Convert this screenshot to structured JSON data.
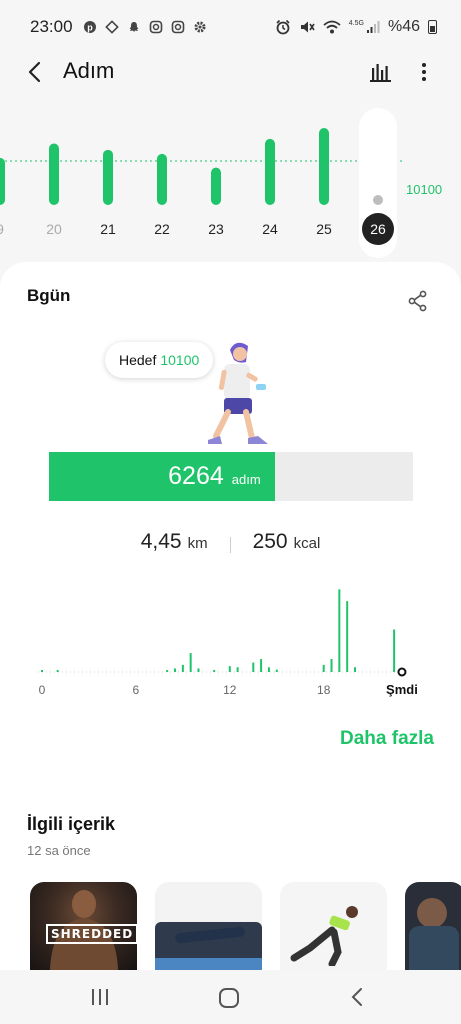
{
  "status_bar": {
    "time": "23:00",
    "battery": "%46",
    "net": "4.5G",
    "left_icons": [
      "pinterest-icon",
      "dropbox-icon",
      "snapchat-icon",
      "instagram-icon",
      "instagram-icon",
      "settings-icon"
    ],
    "right_icons": [
      "alarm-icon",
      "mute-icon",
      "wifi-icon",
      "signal-icon",
      "battery-icon"
    ]
  },
  "header": {
    "title": "Adım",
    "back_icon": "back-arrow-icon",
    "chart_icon": "bar-chart-icon",
    "more_icon": "more-vertical-icon"
  },
  "weekly_chart": {
    "goal_label": "10100",
    "goal": 10100,
    "days": [
      {
        "label": "9",
        "value": 8200,
        "dimmed": true
      },
      {
        "label": "20",
        "value": 10700,
        "dimmed": true
      },
      {
        "label": "21",
        "value": 9600,
        "dimmed": false
      },
      {
        "label": "22",
        "value": 8900,
        "dimmed": false
      },
      {
        "label": "23",
        "value": 6500,
        "dimmed": false
      },
      {
        "label": "24",
        "value": 11500,
        "dimmed": false
      },
      {
        "label": "25",
        "value": 13400,
        "dimmed": false
      },
      {
        "label": "26",
        "value": 6264,
        "selected": true
      }
    ],
    "colors": {
      "bar": "#1fc46a",
      "selected_badge": "#222222"
    }
  },
  "today": {
    "title": "Bgün",
    "share_icon": "share-icon",
    "goal_label": "Hedef",
    "goal_value": "10100",
    "steps": "6264",
    "steps_unit": "adım",
    "progress": 0.62,
    "distance": "4,45",
    "distance_unit": "km",
    "calories": "250",
    "calories_unit": "kcal",
    "more_link": "Daha fazla"
  },
  "chart_data": {
    "type": "bar",
    "x_labels": [
      "0",
      "6",
      "12",
      "18",
      "Şmdi"
    ],
    "x_tick_hours": [
      0,
      6,
      12,
      18,
      23
    ],
    "hours": [
      0,
      0.5,
      1,
      1.5,
      2,
      2.5,
      3,
      3.5,
      4,
      4.5,
      5,
      5.5,
      6,
      6.5,
      7,
      7.5,
      8,
      8.5,
      9,
      9.5,
      10,
      10.5,
      11,
      11.5,
      12,
      12.5,
      13,
      13.5,
      14,
      14.5,
      15,
      15.5,
      16,
      16.5,
      17,
      17.5,
      18,
      18.5,
      19,
      19.5,
      20,
      20.5,
      21,
      21.5,
      22,
      22.5
    ],
    "values": [
      5,
      0,
      10,
      0,
      0,
      0,
      0,
      0,
      0,
      0,
      0,
      0,
      0,
      0,
      0,
      0,
      10,
      30,
      60,
      160,
      30,
      0,
      10,
      0,
      50,
      40,
      0,
      80,
      110,
      40,
      20,
      0,
      0,
      0,
      0,
      0,
      60,
      110,
      700,
      600,
      40,
      0,
      0,
      0,
      0,
      360
    ],
    "ylim": [
      0,
      720
    ],
    "color": "#1fc46a"
  },
  "related": {
    "title": "İlgili içerik",
    "subtitle": "12 sa önce",
    "thumbs": [
      {
        "badge": "SHREDDED"
      },
      {
        "badge": ""
      },
      {
        "badge": ""
      },
      {
        "badge": ""
      }
    ]
  },
  "navbar": {
    "recents_icon": "recents-icon",
    "home_icon": "home-icon",
    "back_icon": "nav-back-icon"
  }
}
